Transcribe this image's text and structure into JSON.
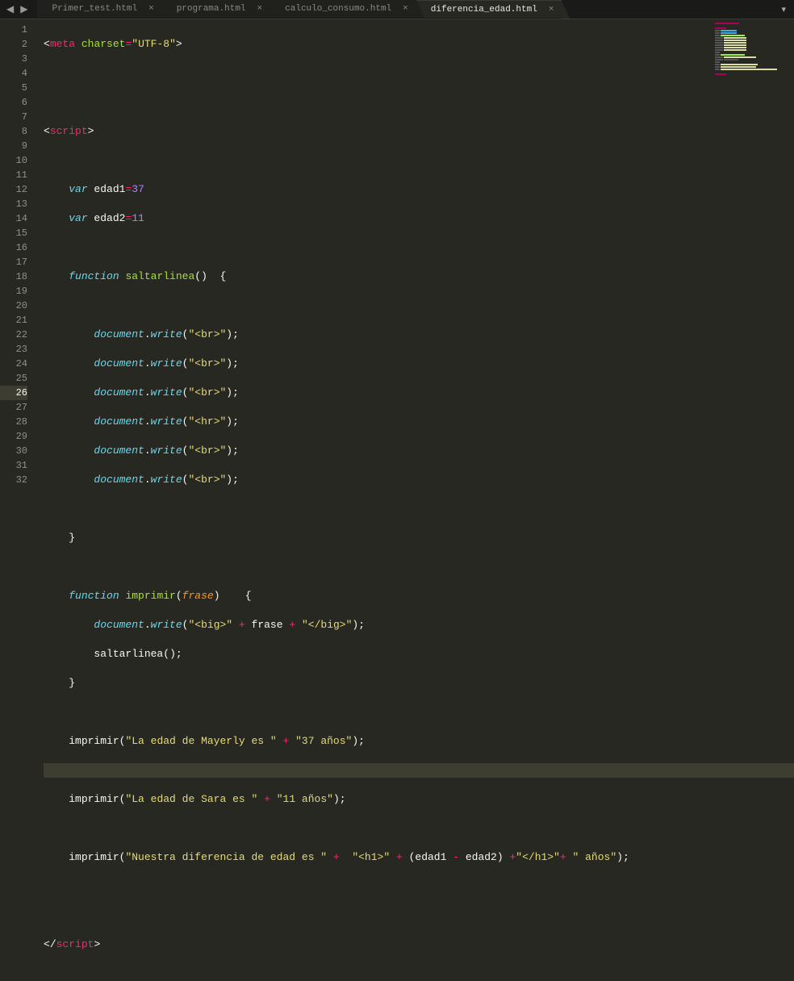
{
  "titlebar": {
    "nav_prev": "◀",
    "nav_next": "▶"
  },
  "tabs": [
    {
      "label": "Primer_test.html",
      "active": false
    },
    {
      "label": "programa.html",
      "active": false
    },
    {
      "label": "calculo_consumo.html",
      "active": false
    },
    {
      "label": "diferencia_edad.html",
      "active": true
    }
  ],
  "more_menu": "▾",
  "highlighted_line": 26,
  "line_numbers": [
    "1",
    "2",
    "3",
    "4",
    "5",
    "6",
    "7",
    "8",
    "9",
    "10",
    "11",
    "12",
    "13",
    "14",
    "15",
    "16",
    "17",
    "18",
    "19",
    "20",
    "21",
    "22",
    "23",
    "24",
    "25",
    "26",
    "27",
    "28",
    "29",
    "30",
    "31",
    "32"
  ],
  "tokens": {
    "lt": "<",
    "gt": ">",
    "slash": "/",
    "meta": "meta",
    "charset": "charset",
    "eq": "=",
    "utf8": "\"UTF-8\"",
    "script": "script",
    "var": "var",
    "edad1": " edad1",
    "edad2": " edad2",
    "val37": "37",
    "val11": "11",
    "function": "function",
    "saltarlinea": "saltarlinea",
    "imprimir": "imprimir",
    "frase": "frase",
    "document": "document",
    "write": "write",
    "br_str": "\"<br>\"",
    "hr_str": "\"<hr>\"",
    "open_big": "\"<big>\"",
    "close_big": "\"</big>\"",
    "plus": "+",
    "minus": "-",
    "lparen": "(",
    "rparen": ")",
    "lbrace": "{",
    "rbrace": "}",
    "semicolon": ";",
    "dot": ".",
    "s_mayerly": "\"La edad de Mayerly es \"",
    "s_37anos": "\"37 años\"",
    "s_sara": "\"La edad de Sara es \"",
    "s_11anos": "\"11 años\"",
    "s_diferencia": "\"Nuestra diferencia de edad es \"",
    "s_h1_open": "\"<h1>\"",
    "s_h1_close": "\"</h1>\"",
    "s_anos": "\" años\"",
    "edad1_id": "edad1",
    "edad2_id": "edad2",
    "frase_id": "frase",
    "saltarlinea_call": "saltarlinea"
  }
}
